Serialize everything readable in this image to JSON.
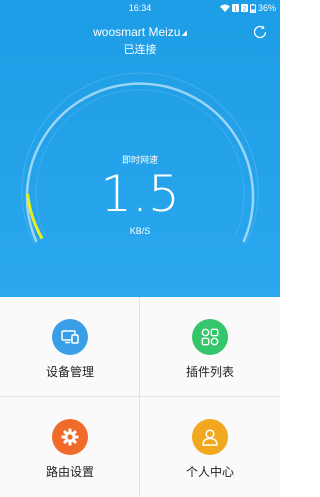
{
  "status_bar": {
    "time": "16:34",
    "battery": "36%"
  },
  "header": {
    "ssid": "woosmart Meizu",
    "ssid_caret": "◢",
    "connection_status": "已连接"
  },
  "speed": {
    "label": "即时网速",
    "value": "1.5",
    "unit": "KB/S",
    "gauge_level": 0.1
  },
  "menu": {
    "items": [
      {
        "label": "设备管理",
        "icon": "devices-icon",
        "color": "#3a9ee6"
      },
      {
        "label": "插件列表",
        "icon": "plugins-icon",
        "color": "#35c56a"
      },
      {
        "label": "路由设置",
        "icon": "settings-gear-icon",
        "color": "#f06a2a"
      },
      {
        "label": "个人中心",
        "icon": "user-icon",
        "color": "#f2a81e"
      }
    ]
  },
  "colors": {
    "primary": "#1e9ee6",
    "gauge_active": "#e8f01c"
  }
}
